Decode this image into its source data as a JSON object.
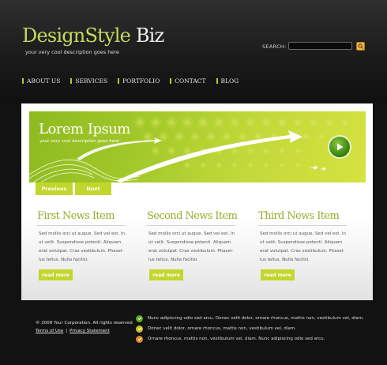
{
  "header": {
    "logo_part1": "DesignStyle",
    "logo_part2": " Biz",
    "tagline": "your very cool description goes here",
    "search_label": "SEARCH:",
    "search_value": ""
  },
  "nav": {
    "items": [
      "ABOUT US",
      "SERVICES",
      "PORTFOLIO",
      "CONTACT",
      "BLOG"
    ]
  },
  "banner": {
    "title": "Lorem Ipsum",
    "subtitle": "your very cool description goes here"
  },
  "pager": {
    "previous": "Previous",
    "next": "Next"
  },
  "columns": [
    {
      "title": "First News Item",
      "lines": [
        "Sed mollis orci ut augue. Sed vel est. In",
        "ut velit. Suspendisse potenti. Aliquam",
        "erat volutpat. Cras vestibulum. Phasel-",
        "lus tellus. Nulla facilisi."
      ],
      "more": "read more"
    },
    {
      "title": "Second News Item",
      "lines": [
        "Sed mollis orci ut augue. Sed vel est. In",
        "ut velit. Suspendisse potenti. Aliquam",
        "erat volutpat. Cras vestibulum. Phasel-",
        "lus tellus. Nulla facilisi."
      ],
      "more": "read more"
    },
    {
      "title": "Third News Item",
      "lines": [
        "Sed mollis orci ut augue. Sed vel est. In",
        "ut velit. Suspendisse potenti. Aliquam",
        "erat volutpat. Cras vestibulum. Phasel-",
        "lus tellus. Nulla facilisi."
      ],
      "more": "read more"
    }
  ],
  "footer": {
    "copyright": "© 2009 Your Corporation. All rights reserved",
    "terms": "Terms of Use",
    "separator": "|",
    "privacy": "Privacy Statement",
    "items": [
      {
        "text": "Nunc adipiscing odio sed arcu. Donec velit dolor, ornare rhoncus, mattis non, vestibulum vel, diam.",
        "icon": "check-icon",
        "color": "#5aa81e"
      },
      {
        "text": "Donec velit dolor, ornare rhoncus, mattis non, vestibulum vel, diam.",
        "icon": "check-icon",
        "color": "#c8c21c"
      },
      {
        "text": "Ornare rhoncus, mattis non, vestibulum vel, diam. Nunc adipiscing odio sed arcu.",
        "icon": "check-icon",
        "color": "#e0862a"
      }
    ]
  },
  "colors": {
    "accent_green": "#c3d62c",
    "title_green": "#93ad2a",
    "logo_green": "#c4db5d",
    "search_button": "#f0b64a"
  }
}
